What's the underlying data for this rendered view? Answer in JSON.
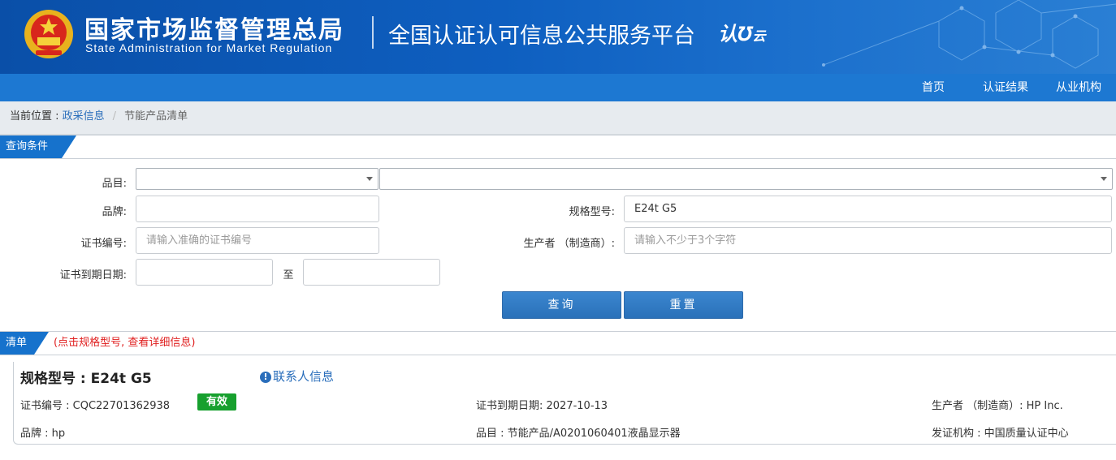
{
  "header": {
    "gov_title": "国家市场监督管理总局",
    "gov_subtitle": "State Administration  for  Market Regulation",
    "platform_title": "全国认证认可信息公共服务平台",
    "platform_logo": "认",
    "platform_logo_small": "云"
  },
  "nav": {
    "items": [
      "首页",
      "认证结果",
      "从业机构"
    ]
  },
  "breadcrumb": {
    "label": "当前位置 : ",
    "link": "政采信息",
    "separator": "/",
    "current": "节能产品清单"
  },
  "query_section": {
    "title": "查询条件"
  },
  "form": {
    "category_label": "品目:",
    "brand_label": "品牌:",
    "brand_value": "",
    "model_label": "规格型号:",
    "model_value": "E24t G5",
    "cert_no_label": "证书编号:",
    "cert_no_placeholder": "请输入准确的证书编号",
    "maker_label": "生产者 （制造商）:",
    "maker_placeholder": "请输入不少于3个字符",
    "expiry_label": "证书到期日期:",
    "to_label": "至",
    "search_button": "查询",
    "reset_button": "重置"
  },
  "list_section": {
    "title": "清单",
    "note": "(点击规格型号, 查看详细信息)"
  },
  "result": {
    "model_title": "规格型号 : E24t G5",
    "contact_icon": "info-icon",
    "contact_link": "联系人信息",
    "cert_no": "证书编号 : CQC22701362938",
    "status_badge": "有效",
    "expiry": "证书到期日期: 2027-10-13",
    "maker": "生产者 （制造商）: HP Inc.",
    "brand": "品牌 : hp",
    "category": "品目 : 节能产品/A0201060401液晶显示器",
    "issuer": "发证机构 : 中国质量认证中心"
  },
  "colors": {
    "header_blue": "#0e5fc0",
    "nav_blue": "#1d78d2",
    "button_blue": "#3b86cf",
    "valid_green": "#17a02e",
    "note_red": "#e02020"
  }
}
